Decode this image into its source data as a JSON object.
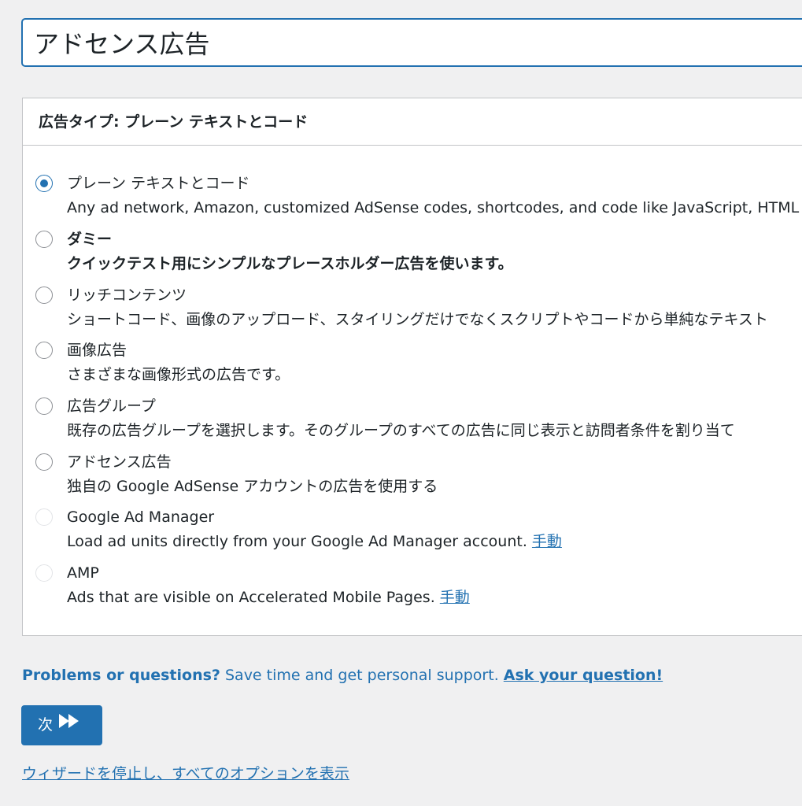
{
  "title_input": {
    "value": "アドセンス広告"
  },
  "ad_type_box": {
    "header": "広告タイプ: プレーン テキストとコード",
    "options": [
      {
        "label": "プレーン テキストとコード",
        "description": "Any ad network, Amazon, customized AdSense codes, shortcodes, and code like JavaScript, HTML",
        "state": "selected"
      },
      {
        "label": "ダミー",
        "description": "クイックテスト用にシンプルなプレースホルダー広告を使います。",
        "state": "unselected"
      },
      {
        "label": "リッチコンテンツ",
        "description": "ショートコード、画像のアップロード、スタイリングだけでなくスクリプトやコードから単純なテキスト",
        "state": "unselected"
      },
      {
        "label": "画像広告",
        "description": "さまざまな画像形式の広告です。",
        "state": "unselected"
      },
      {
        "label": "広告グループ",
        "description": "既存の広告グループを選択します。そのグループのすべての広告に同じ表示と訪問者条件を割り当て",
        "state": "unselected"
      },
      {
        "label": "アドセンス広告",
        "description": "独自の Google AdSense アカウントの広告を使用する",
        "state": "unselected"
      },
      {
        "label": "Google Ad Manager",
        "description": "Load ad units directly from your Google Ad Manager account.",
        "link": "手動",
        "state": "disabled"
      },
      {
        "label": "AMP",
        "description": "Ads that are visible on Accelerated Mobile Pages.",
        "link": "手動",
        "state": "disabled"
      }
    ]
  },
  "help": {
    "lead": "Problems or questions?",
    "text": "Save time and get personal support.",
    "link": "Ask your question!"
  },
  "next_button": {
    "label": "次",
    "icon": "fast-forward-icon"
  },
  "wizard_link": "ウィザードを停止し、すべてのオプションを表示",
  "colors": {
    "accent": "#2271b1",
    "background": "#f0f0f1",
    "border": "#c3c4c7"
  }
}
